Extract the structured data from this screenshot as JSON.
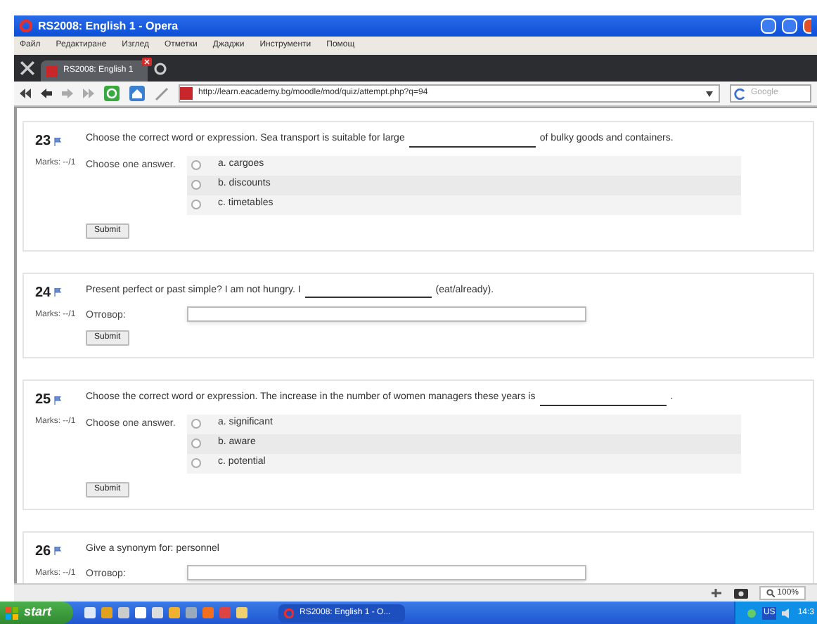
{
  "window": {
    "title": "RS2008: English 1 - Opera"
  },
  "menu": [
    "Файл",
    "Редактиране",
    "Изглед",
    "Отметки",
    "Джаджи",
    "Инструменти",
    "Помощ"
  ],
  "tabs": [
    {
      "label": "RS2008: English 1",
      "selected": true
    }
  ],
  "address_bar": {
    "url": "http://learn.eacademy.bg/moodle/mod/quiz/attempt.php?q=94"
  },
  "search": {
    "placeholder": "Google"
  },
  "questions": [
    {
      "number": "23",
      "marks": "Marks: --/1",
      "kind": "choice",
      "text_before": "Choose the correct word or expression. Sea transport is suitable for large",
      "blank": true,
      "text_after": "of bulky goods and containers.",
      "label": "Choose one answer.",
      "options": [
        {
          "label": "a. cargoes",
          "selected": false
        },
        {
          "label": "b. discounts",
          "selected": false
        },
        {
          "label": "c. timetables",
          "selected": false
        }
      ],
      "submit": "Submit"
    },
    {
      "number": "24",
      "marks": "Marks: --/1",
      "kind": "text",
      "text_before": "Present perfect or past simple? I am not hungry. I",
      "blank": true,
      "text_after": "(eat/already).",
      "label": "Отговор:",
      "submit": "Submit"
    },
    {
      "number": "25",
      "marks": "Marks: --/1",
      "kind": "choice",
      "text_before": "Choose the correct word or expression. The increase in the number of women managers these years is",
      "blank": true,
      "text_after": ".",
      "label": "Choose one answer.",
      "options": [
        {
          "label": "a. significant",
          "selected": false
        },
        {
          "label": "b. aware",
          "selected": false
        },
        {
          "label": "c. potential",
          "selected": false
        }
      ],
      "submit": "Submit"
    },
    {
      "number": "26",
      "marks": "Marks: --/1",
      "kind": "text",
      "text_before": "Give a synonym for: personnel",
      "blank": false,
      "label": "Отговор:"
    }
  ],
  "status_bar": {
    "zoom": "100%"
  },
  "taskbar": {
    "start": "start",
    "task": "RS2008: English 1 - O...",
    "language": "US",
    "clock": "14:3"
  }
}
